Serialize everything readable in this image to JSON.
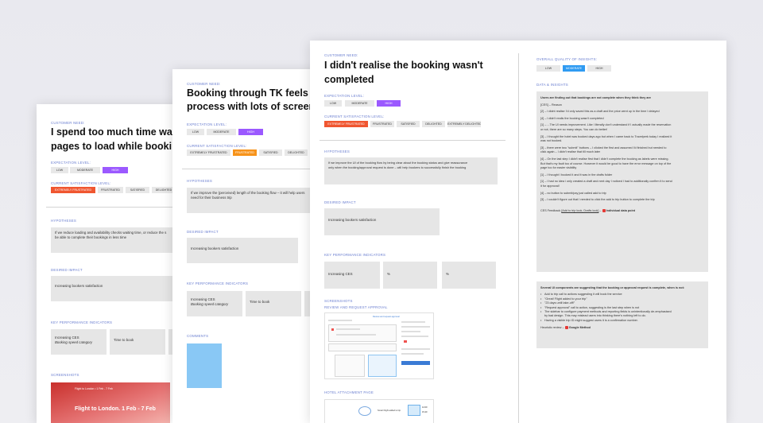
{
  "board1": {
    "need_label": "CUSTOMER NEED:",
    "title_line1": "I spend too much time waiti",
    "title_line2": "pages to load while booking",
    "expectation_label": "EXPECTATION LEVEL:",
    "expectation_options": [
      "LOW",
      "MODERATE",
      "HIGH"
    ],
    "satisfaction_label": "CURRENT SATISFACTION LEVEL:",
    "satisfaction_options": [
      "EXTREMELY FRUSTRATED",
      "FRUSTRATED",
      "SATISFIED",
      "DELIGHTED"
    ],
    "hypotheses_label": "HYPOTHESES",
    "hypothesis_line1": "If we reduce loading and availability checks waiting time, or reduce the s",
    "hypothesis_line2": "be able to complete their bookings in less time",
    "impact_label": "DESIRED IMPACT",
    "impact_text": "Increasing bookers satisfaction",
    "kpi_label": "KEY PERFORMANCE INDICATORS",
    "kpi1_line1": "Increasing CES",
    "kpi1_line2": "Booking speed category",
    "kpi2": "Time to book",
    "screenshots_label": "SCREENSHOTS",
    "screenshot_caption": "Flight to London. 1 Feb - 7 Feb",
    "screenshot_topline": "Flight to London • 1 Feb - 7 Feb"
  },
  "board2": {
    "need_label": "CUSTOMER NEED:",
    "title_line1": "Booking through TK feels lik",
    "title_line2": "process with lots of screens",
    "expectation_label": "EXPECTATION LEVEL:",
    "expectation_options": [
      "LOW",
      "MODERATE",
      "HIGH"
    ],
    "satisfaction_label": "CURRENT SATISFACTION LEVEL:",
    "satisfaction_options": [
      "EXTREMELY FRUSTRATED",
      "FRUSTRATED",
      "SATISFIED",
      "DELIGHTED"
    ],
    "hypotheses_label": "HYPOTHESES",
    "hypothesis_line1": "If we improve the (perceived) length of the booking flow – it will help users",
    "hypothesis_line2": "need for their business trip",
    "impact_label": "DESIRED IMPACT",
    "impact_text": "Increasing bookers satisfaction",
    "kpi_label": "KEY PERFORMANCE INDICATORS",
    "kpi1_line1": "Increasing CES",
    "kpi1_line2": "Booking speed category",
    "kpi2": "Time to book",
    "comments_label": "COMMENTS"
  },
  "board3": {
    "need_label": "CUSTOMER NEED:",
    "title_line1": "I didn't realise the booking wasn't",
    "title_line2": "completed",
    "expectation_label": "EXPECTATION LEVEL:",
    "expectation_options": [
      "LOW",
      "MODERATE",
      "HIGH"
    ],
    "satisfaction_label": "CURRENT SATISFACTION LEVEL:",
    "satisfaction_options": [
      "EXTREMELY FRUSTRATED",
      "FRUSTRATED",
      "SATISFIED",
      "DELIGHTED",
      "EXTREMELY DELIGHTED"
    ],
    "hypotheses_label": "HYPOTHESES",
    "hypothesis_line1": "If we improve the UI of the booking flow by being clear about the booking status and give reassurance",
    "hypothesis_line2": "only when the booking/approval request is done – will help bookers to successfully finish the booking",
    "impact_label": "DESIRED IMPACT",
    "impact_text": "Increasing bookers satisfaction",
    "kpi_label": "KEY PERFORMANCE INDICATORS",
    "kpi1": "Increasing CES",
    "kpi2": "%",
    "kpi3": "%",
    "screenshots_label": "SCREENSHOTS",
    "ss1_label": "REVIEW AND REQUEST APPROVAL",
    "ss2_label": "HOTEL ATTACHMENT PAGE",
    "ss1_heading": "Review and request approval",
    "ss1_subheading": "Add to trip",
    "ss2_hotel_label": "Smart Flight added to trip",
    "ss2_price1": "12.00",
    "ss2_price2": "15.40",
    "insights_quality_label": "OVERALL QUALITY OF INSIGHTS:",
    "insights_quality_options": [
      "LOW",
      "MODERATE",
      "HIGH"
    ],
    "data_label": "DATA & INSIGHTS",
    "insight1_title": "Users are finding out that bookings are not complete when they think they are",
    "insight1_lines": [
      "[CES] – Reason",
      "",
      "[2] – I didnt realise I'd only saved this as a draft and the price went up in the time I delayed",
      "",
      "[4] – I didn't realis the booking wasn't completed",
      "",
      "[1] – ...The UI needs improvement. Like I literally don't understand if I actually made the reservation",
      "or not, there are so many steps. You can do better!",
      "",
      "[3] – I thought the hotel was booked days ago but when I came back to Travelperk today I realized it",
      "was not booked.",
      "",
      "[3] – there were two \"submit\" buttons – I clicked the first and assumed I'd finished but needed to",
      "click again – I didn't realise that till much later",
      "",
      "[4] – On the last step I didn't realise first that I didn't complete the booking as labels were missing.",
      "But that's my fault too of course. However it would be good to have the error message on top of the",
      "page too for easier visibility",
      "",
      "[1] – I thought I booked it and it was in the drafts folder",
      "",
      "[1] – I had no idea i only created a draft and next day I noticed I had to additionally confirm it to send",
      "it for approval!",
      "",
      "[4] – no button to submit/pay  just called add to trip",
      "",
      "[3] – I couldn't figure out that I needed to click the add to trip button to complete the trip"
    ],
    "insight1_footer_prefix": "CES Feedback ",
    "insight1_footer_links": "[Add to trip look, Drafts look]",
    "insight1_footer_suffix": " Individual data point",
    "insight2_title": "Several UI components are suggesting that the booking or approval request is complete, when is not:",
    "insight2_bullets": [
      "Add to trip call to actions suggesting it will book the service",
      "\"Great! Flight added to your trip\"",
      "\"23 days until take-off!\"",
      "\"Request approval\" call to action, suggesting is the last step when is not",
      "The sidebar to configure payment methods and reporting fields is unintentionally de-emphasised",
      "by bad design. This may mislead users into thinking there's nothing left to do.",
      "Having a visible trip ID might suggest users it is a confirmation number."
    ],
    "insight2_footer": "Heuristic review – ",
    "insight2_footer_source": "Google Method"
  },
  "colors": {
    "accent_label": "#6b7fd0",
    "high_purple": "#9b59ff",
    "extreme_red": "#f05630",
    "frustrated_orange": "#f7931a",
    "moderate_blue": "#2f9bf2",
    "sticky_blue": "#89c8f5"
  }
}
